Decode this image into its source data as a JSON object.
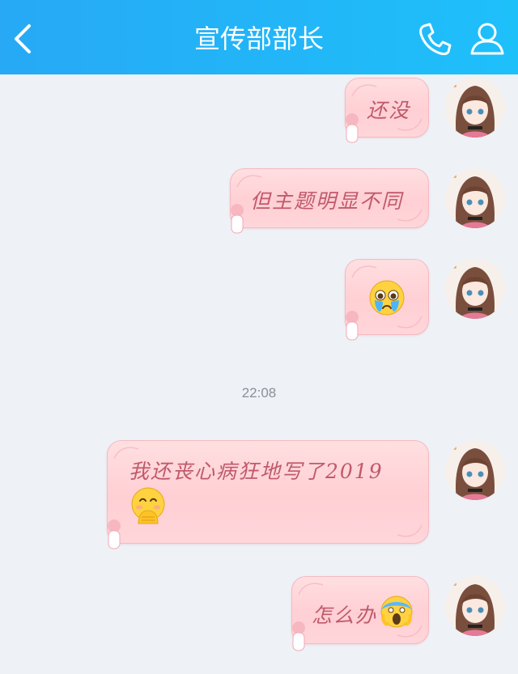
{
  "header": {
    "title": "宣传部部长",
    "background_color": "#27a9f5",
    "icons": [
      "back-arrow-icon",
      "phone-icon",
      "profile-icon"
    ]
  },
  "messages": [
    {
      "text": "还没"
    },
    {
      "text": "但主题明显不同"
    },
    {
      "text": "",
      "emoji": "crying-face-emoji"
    },
    {
      "text": "我还丧心病狂地写了2019",
      "emoji": "hand-over-mouth-emoji"
    },
    {
      "text": "怎么办",
      "emoji": "screaming-face-emoji"
    }
  ],
  "timestamp": "22:08",
  "colors": {
    "bubble": "#ffd6da",
    "bubble_text": "#c05a6b",
    "background": "#eef1f6"
  }
}
